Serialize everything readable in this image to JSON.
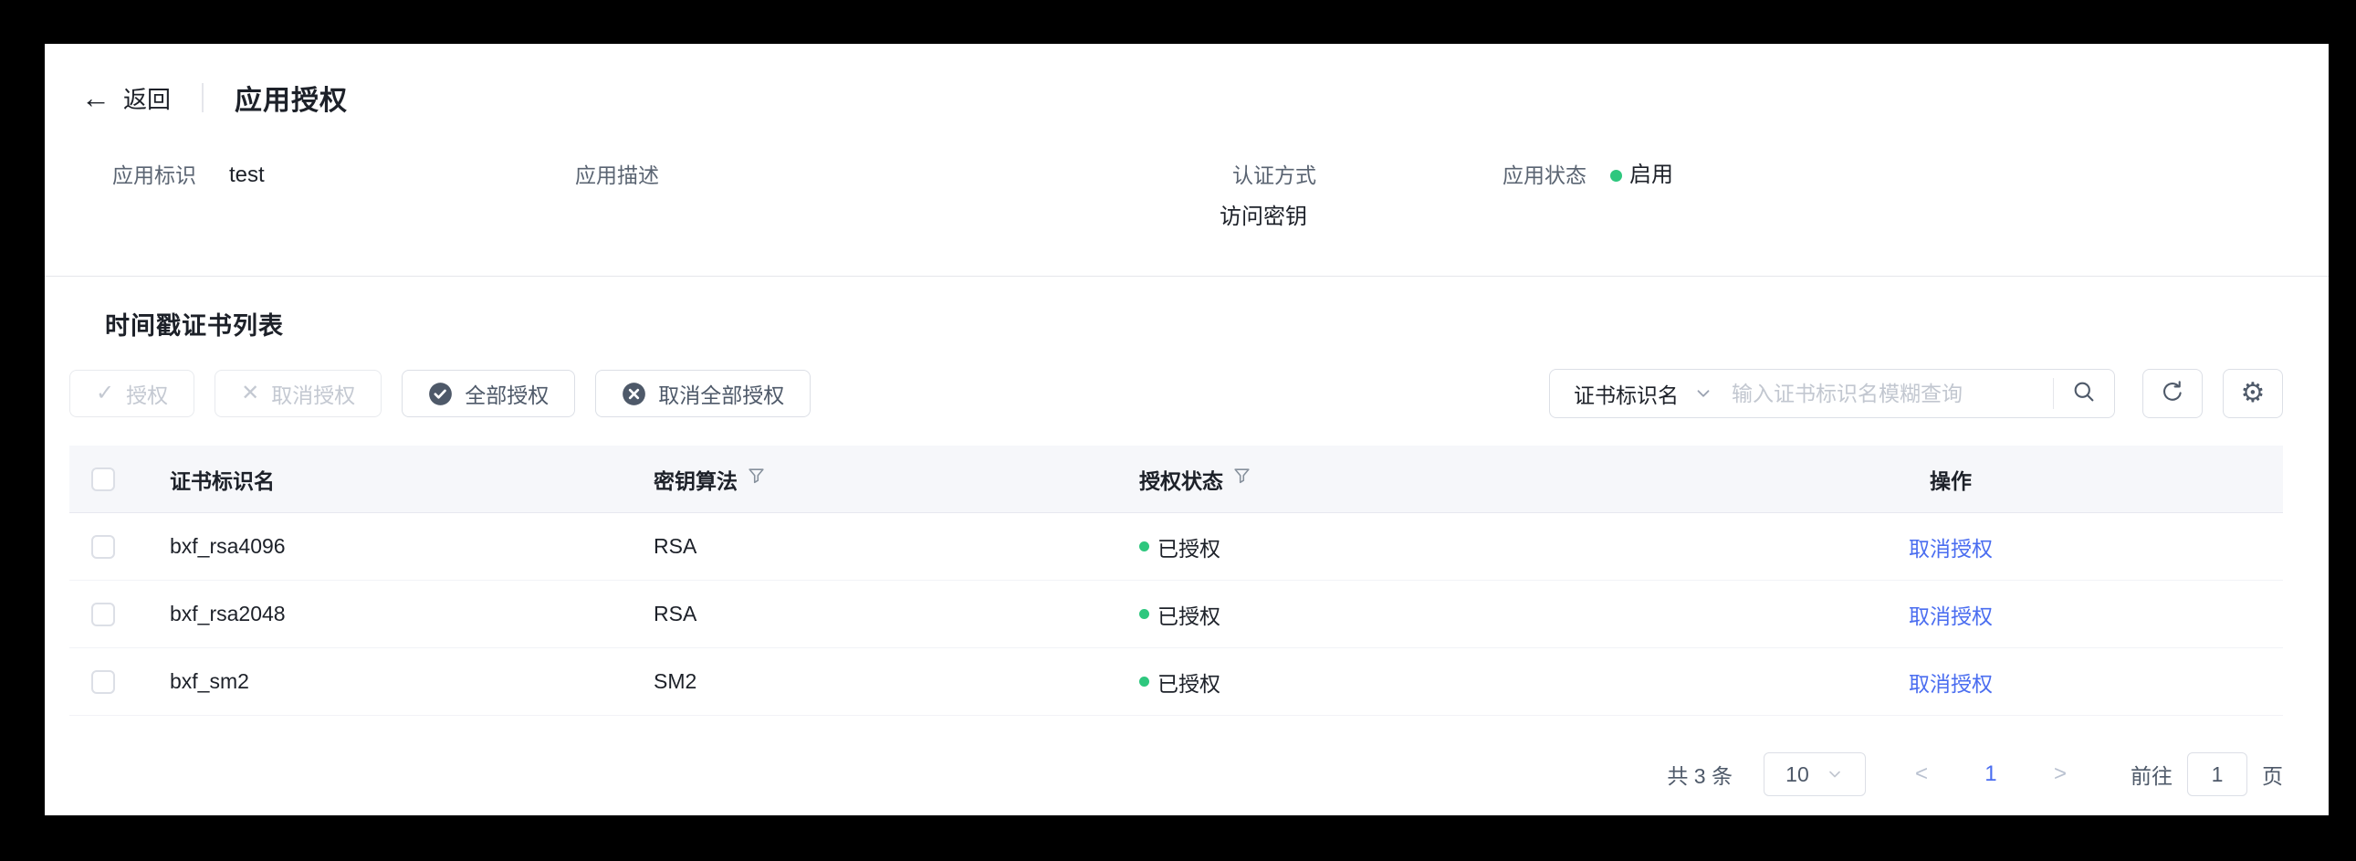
{
  "header": {
    "back": "返回",
    "title": "应用授权"
  },
  "info": {
    "app_id_label": "应用标识",
    "app_id_value": "test",
    "app_desc_label": "应用描述",
    "app_desc_value": "",
    "auth_method_label": "认证方式",
    "auth_method_value": "访问密钥",
    "app_status_label": "应用状态",
    "app_status_value": "启用"
  },
  "section_title": "时间戳证书列表",
  "toolbar": {
    "authorize": "授权",
    "revoke": "取消授权",
    "authorize_all": "全部授权",
    "revoke_all": "取消全部授权",
    "search_field": "证书标识名",
    "search_placeholder": "输入证书标识名模糊查询",
    "icons": [
      "check-icon",
      "x-icon",
      "check-circle-icon",
      "x-circle-icon",
      "search-icon",
      "refresh-icon",
      "gear-icon"
    ]
  },
  "table": {
    "col_cert": "证书标识名",
    "col_alg": "密钥算法",
    "col_status": "授权状态",
    "col_action": "操作",
    "rows": [
      {
        "cert": "bxf_rsa4096",
        "alg": "RSA",
        "status": "已授权",
        "action": "取消授权"
      },
      {
        "cert": "bxf_rsa2048",
        "alg": "RSA",
        "status": "已授权",
        "action": "取消授权"
      },
      {
        "cert": "bxf_sm2",
        "alg": "SM2",
        "status": "已授权",
        "action": "取消授权"
      }
    ]
  },
  "pagination": {
    "total": "共 3 条",
    "page_size": "10",
    "prev": "<",
    "current": "1",
    "next": ">",
    "goto": "前往",
    "goto_value": "1",
    "unit": "页"
  },
  "colors": {
    "accent_blue": "#4a6df0",
    "status_green": "#2ec77e",
    "text_primary": "#1d2129",
    "text_secondary": "#4e5969"
  }
}
